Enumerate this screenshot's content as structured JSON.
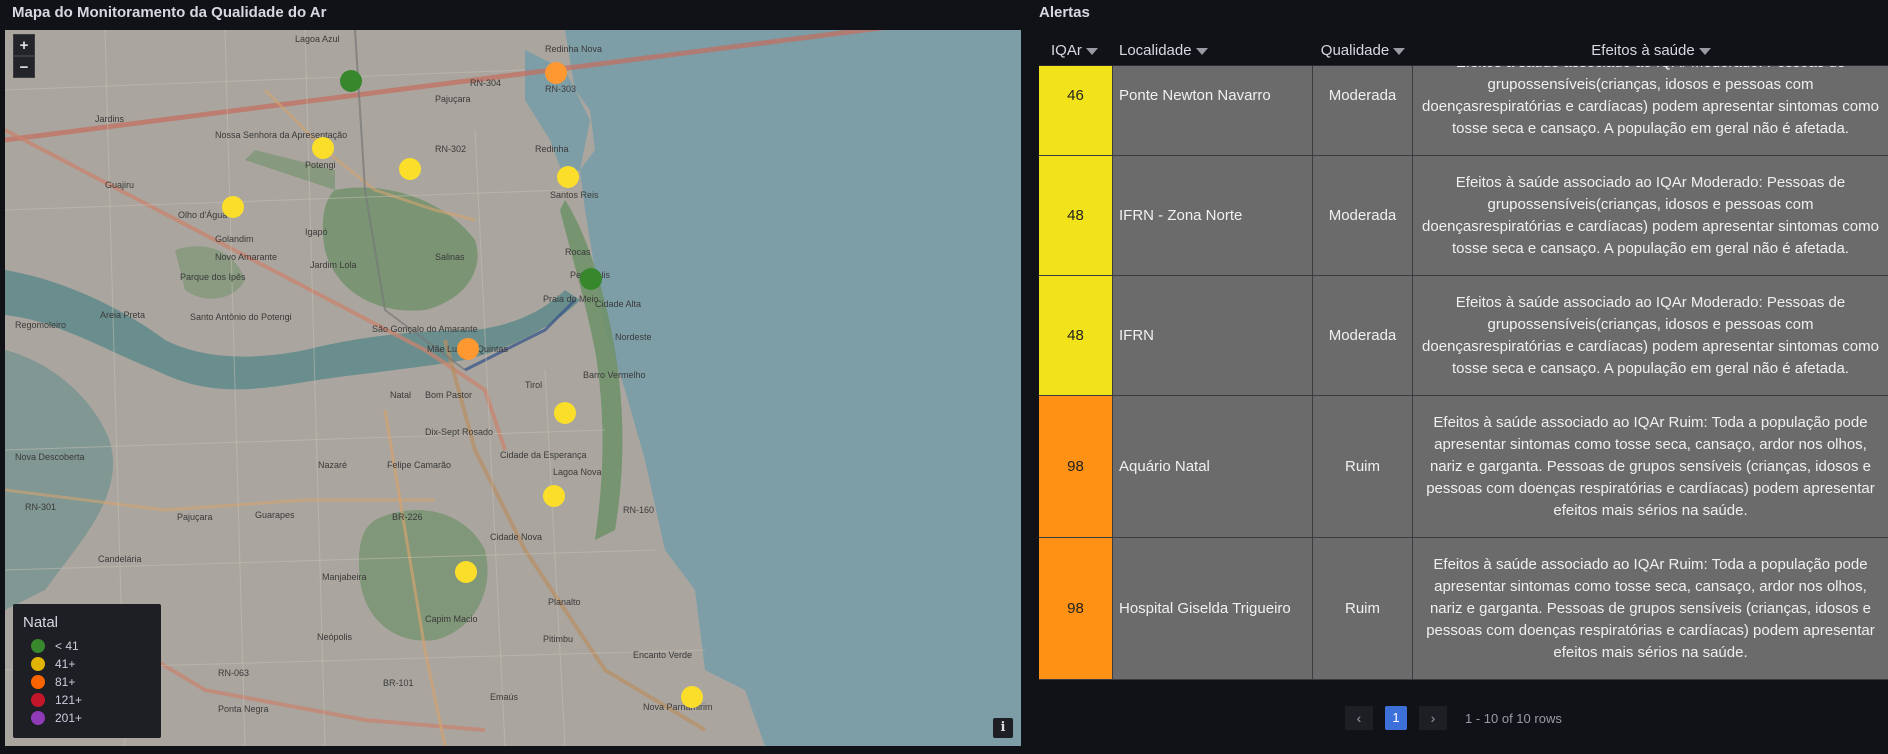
{
  "map_panel": {
    "title": "Mapa do Monitoramento da Qualidade do Ar",
    "zoom_in": "+",
    "zoom_out": "−",
    "info": "i",
    "map_labels": [
      "Lagoa Azul",
      "Redinha Nova",
      "Pajuçara",
      "RN-303",
      "RN-304",
      "Jardins",
      "Nossa Senhora da Apresentação",
      "Potengi",
      "RN-302",
      "Redinha",
      "Guajiru",
      "Santos Reis",
      "Olho d'Água",
      "Igapó",
      "Golandim",
      "Novo Amarante",
      "Jardim Lola",
      "Salinas",
      "Rocas",
      "Parque dos Ipês",
      "Petrópolis",
      "Praia do Meio",
      "Cidade Alta",
      "Areia Preta",
      "Santo Antônio do Potengi",
      "Regomoleiro",
      "São Gonçalo do Amarante",
      "Nordeste",
      "Mãe Luiza",
      "Quintas",
      "Barro Vermelho",
      "Tirol",
      "Natal",
      "Bom Pastor",
      "Dix-Sept Rosado",
      "Nazaré",
      "Felipe Camarão",
      "Cidade da Esperança",
      "Lagoa Nova",
      "Nova Descoberta",
      "RN-160",
      "RN-301",
      "Pajuçara",
      "BR-226",
      "Guarapes",
      "Cidade Nova",
      "Candelária",
      "Manjabeira",
      "Planalto",
      "Capim Macio",
      "Pitimbu",
      "Neópolis",
      "Encanto Verde",
      "RN-063",
      "BR-101",
      "Emaús",
      "Nova Parnamirim",
      "Ponta Negra",
      "BR-304"
    ],
    "legend": {
      "title": "Natal",
      "items": [
        {
          "label": "< 41",
          "color": "#37872d"
        },
        {
          "label": "41+",
          "color": "#e0b400"
        },
        {
          "label": "81+",
          "color": "#fa6400"
        },
        {
          "label": "121+",
          "color": "#c4162a"
        },
        {
          "label": "201+",
          "color": "#8f3bb8"
        }
      ]
    },
    "markers": [
      {
        "color": "#37872d"
      },
      {
        "color": "#ff9830"
      },
      {
        "color": "#fade2a"
      },
      {
        "color": "#fade2a"
      },
      {
        "color": "#fade2a"
      },
      {
        "color": "#fade2a"
      },
      {
        "color": "#37872d"
      },
      {
        "color": "#ff9830"
      },
      {
        "color": "#fade2a"
      },
      {
        "color": "#fade2a"
      },
      {
        "color": "#fade2a"
      },
      {
        "color": "#fade2a"
      }
    ]
  },
  "alerts_panel": {
    "title": "Alertas",
    "columns": [
      "IQAr",
      "Localidade",
      "Qualidade",
      "Efeitos à saúde"
    ],
    "rows": [
      {
        "iqar": "46",
        "localidade": "Ponte Newton Navarro",
        "qualidade": "Moderada",
        "efeitos": "Efeitos à saúde associado ao IQAr Moderado: Pessoas de grupossensíveis(crianças, idosos e pessoas com doençasrespiratórias e cardíacas) podem apresentar sintomas como tosse seca e cansaço. A população em geral não é afetada.",
        "color": "#f2e21a"
      },
      {
        "iqar": "48",
        "localidade": "IFRN - Zona Norte",
        "qualidade": "Moderada",
        "efeitos": "Efeitos à saúde associado ao IQAr Moderado: Pessoas de grupossensíveis(crianças, idosos e pessoas com doençasrespiratórias e cardíacas) podem apresentar sintomas como tosse seca e cansaço. A população em geral não é afetada.",
        "color": "#f2e21a"
      },
      {
        "iqar": "48",
        "localidade": "IFRN",
        "qualidade": "Moderada",
        "efeitos": "Efeitos à saúde associado ao IQAr Moderado: Pessoas de grupossensíveis(crianças, idosos e pessoas com doençasrespiratórias e cardíacas) podem apresentar sintomas como tosse seca e cansaço. A população em geral não é afetada.",
        "color": "#f2e21a"
      },
      {
        "iqar": "98",
        "localidade": "Aquário Natal",
        "qualidade": "Ruim",
        "efeitos": "Efeitos à saúde associado ao IQAr Ruim: Toda a população pode apresentar sintomas como tosse seca, cansaço, ardor nos olhos, nariz e garganta. Pessoas de grupos sensíveis (crianças, idosos e pessoas com doenças respiratórias e cardíacas) podem apresentar efeitos mais sérios na saúde.",
        "color": "#ff9214"
      },
      {
        "iqar": "98",
        "localidade": "Hospital Giselda Trigueiro",
        "qualidade": "Ruim",
        "efeitos": "Efeitos à saúde associado ao IQAr Ruim: Toda a população pode apresentar sintomas como tosse seca, cansaço, ardor nos olhos, nariz e garganta. Pessoas de grupos sensíveis (crianças, idosos e pessoas com doenças respiratórias e cardíacas) podem apresentar efeitos mais sérios na saúde.",
        "color": "#ff9214"
      }
    ],
    "pager": {
      "prev": "‹",
      "current": "1",
      "next": "›",
      "info": "1 - 10 of 10 rows"
    }
  }
}
